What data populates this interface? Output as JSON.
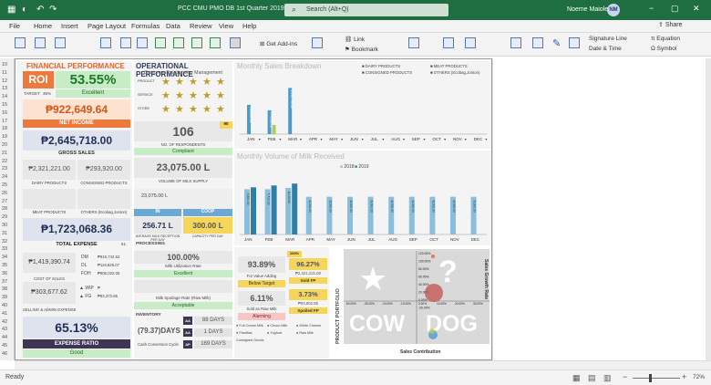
{
  "titlebar": {
    "doc_title": "PCC CMU PMO DB 1st Quarter 2019.2  -  Excel",
    "search": "Search (Alt+Q)",
    "user": "Noeme Maiole",
    "initials": "NM"
  },
  "menu": [
    "File",
    "Home",
    "Insert",
    "Page Layout",
    "Formulas",
    "Data",
    "Review",
    "View",
    "Help"
  ],
  "share": "Share",
  "ribbon": {
    "get_addins": "Get Add-ins",
    "link": "Link",
    "bookmark": "Bookmark",
    "signature": "Signature Line",
    "datetime": "Date & Time",
    "equation": "Equation",
    "symbol": "Symbol"
  },
  "rows": [
    "10",
    "11",
    "12",
    "13",
    "14",
    "15",
    "16",
    "17",
    "18",
    "19",
    "20",
    "21",
    "22",
    "23",
    "24",
    "25",
    "26",
    "27",
    "28",
    "29",
    "30",
    "31",
    "32",
    "33",
    "34",
    "35",
    "36",
    "37",
    "38",
    "39",
    "40",
    "41",
    "42",
    "43",
    "44",
    "45",
    "46"
  ],
  "fin": {
    "title": "FINANCIAL PERFORMANCE",
    "roi_label": "ROI",
    "roi_value": "53.55%",
    "target_label": "TARGET",
    "target_value": "35%",
    "status": "Excellent",
    "net_income_value": "₱922,649.64",
    "net_income_label": "NET INCOME",
    "gross_value": "₱2,645,718.00",
    "gross_label": "GROSS SALES",
    "dairy_value": "₱2,321,221.00",
    "consigned_value": "₱293,920.00",
    "dairy_label": "DAIRY PRODUCTS",
    "consigned_label": "CONSIGNED PRODUCTS",
    "meat_label": "MEAT PRODUCTS",
    "others_label": "OTHERS (Ecobag,Jonton)",
    "total_expense_value": "₱1,723,068.36",
    "total_expense_label": "TOTAL EXPENSE",
    "total_expense_tag": "51",
    "cos_value": "₱1,419,390.74",
    "cos_label": "COST OF SALES",
    "dm_label": "DM",
    "dl_label": "DL",
    "foh_label": "FOH",
    "dm_value": "₱916,742.62",
    "dl_value": "₱119,826.07",
    "foh_value": "₱906,022.05",
    "wip_label": "WIP",
    "fg_label": "FG",
    "wip_value": "₱",
    "fg_value": "₱93,372.85",
    "sga_value": "₱303,677.62",
    "sga_label": "SELLING & ADMIN EXPENSE",
    "ratio_value": "65.13%",
    "ratio_label": "EXPENSE RATIO",
    "ratio_status": "Good"
  },
  "ops": {
    "title": "OPERATIONAL PERFORMANCE",
    "crm_title": "Customer Relationship Management",
    "crm_rows": [
      "PRODUCT",
      "SERVICE",
      "STORE"
    ],
    "respondents_value": "106",
    "respondents_label": "NO. OF RESPONDENTS",
    "respondents_tag": "90",
    "respondents_status": "Compliant",
    "milk_supply_value": "23,075.00 L",
    "milk_supply_label": "VOLUME OF MILK SUPPLY",
    "milk_small": "23,075.00 L",
    "in_label": "IN",
    "coop_label": "COOP",
    "avg_value": "256.71 L",
    "avg_label": "AVERAGE MILK RECEPTION PER DAY",
    "cap_value": "300.00 L",
    "cap_label": "CAPACITY PER DAY",
    "processing_label": "PROCESSING",
    "util_value": "100.00%",
    "util_label": "Milk Utilization Rate",
    "util_status": "Excellent",
    "util_tag": "100%",
    "spoil_tag": "0.93%",
    "spoil_label": "Milk Spoilage Rate (Raw Milk)",
    "spoil_status": "Acceptable",
    "inventory_label": "INVENTORY",
    "inv_value": "(79.37)DAYS",
    "ccc_label": "Cash Conversion Cycle",
    "aa1": "AA",
    "aa2": "AA",
    "ap": "AP",
    "days1": "88 DAYS",
    "days2": "1 DAYS",
    "days3": "169 DAYS",
    "va_value": "93.89%",
    "va_label": "For Value Adding",
    "va_status": "Below Target",
    "raw_value": "6.11%",
    "raw_label": "Sold as Raw Milk",
    "raw_status": "Alarming",
    "sold_fp_value": "96.27%",
    "sold_fp_amount": "₱2,321,221.00",
    "sold_fp_label": "Sold FP",
    "spoiled_value": "3.73%",
    "spoiled_amount": "₱93,802.85",
    "spoiled_label": "Spoiled FP",
    "va_tag": "100%",
    "legend_items": [
      "Full Cream Milk",
      "Choco Milk",
      "White Cheese",
      "Pastillas",
      "Yoghurt",
      "Raw Milk"
    ],
    "legend_extra": "Consigned Goods"
  },
  "portfolio": {
    "vertical_label": "PRODUCT PORTFOLIO",
    "cow": "COW",
    "dog": "DOG",
    "q": "?",
    "x_label": "Sales Contribution",
    "y_label": "Sales Growth Rate",
    "y_ticks": [
      "120.00%",
      "100.00%",
      "80.00%",
      "60.00%",
      "40.00%",
      "20.00%",
      "0.00%",
      "-20.00%"
    ],
    "x_ticks": [
      "-50.00%",
      "-30.00%",
      "-20.00%",
      "-10.00%",
      "0.00%",
      "10.00%",
      "20.00%",
      "30.00%"
    ]
  },
  "sales_chart": {
    "title": "Monthly Sales Breakdown",
    "legend": [
      "DAIRY PRODUCTS",
      "MEAT PRODUCTS",
      "CONSIGNED PRODUCTS",
      "OTHERS (Ecobag,Jonton)"
    ],
    "months": [
      "JAN",
      "FEB",
      "MAR",
      "APR",
      "MAY",
      "JUN",
      "JUL",
      "AUG",
      "SEP",
      "OCT",
      "NOV",
      "DEC"
    ],
    "dairy": [
      950282,
      774922,
      1500000,
      0,
      0,
      0,
      0,
      0,
      0,
      0,
      0,
      0
    ],
    "consigned": [
      0,
      296000,
      0,
      0,
      0,
      0,
      0,
      0,
      0,
      0,
      0,
      0
    ],
    "labels": [
      "950,282.00",
      "774,922.00",
      "1,596,793.00"
    ]
  },
  "milk_chart": {
    "title": "Monthly Volume of Milk Received",
    "legend": [
      "2018",
      "2019"
    ],
    "months": [
      "JAN",
      "FEB",
      "MAR",
      "APR",
      "MAY",
      "JUN",
      "JUL",
      "AUG",
      "SEP",
      "OCT",
      "NOV",
      "DEC"
    ],
    "v2018": [
      7200,
      7200,
      7400,
      6000,
      6000,
      6000,
      6000,
      6000,
      6000,
      6000,
      6000,
      6000
    ],
    "v2019": [
      7500,
      7800,
      8100,
      0,
      0,
      0,
      0,
      0,
      0,
      0,
      0,
      0
    ],
    "labels": [
      "7,500.00",
      "7,710.00",
      "8,100.00",
      "6,000.00",
      "6,000.00",
      "6,000.00",
      "6,000.00",
      "6,000.00",
      "6,000.00",
      "6,000.00",
      "6,000.00",
      "6,000.00"
    ]
  },
  "status": {
    "ready": "Ready",
    "zoom": "72%"
  }
}
